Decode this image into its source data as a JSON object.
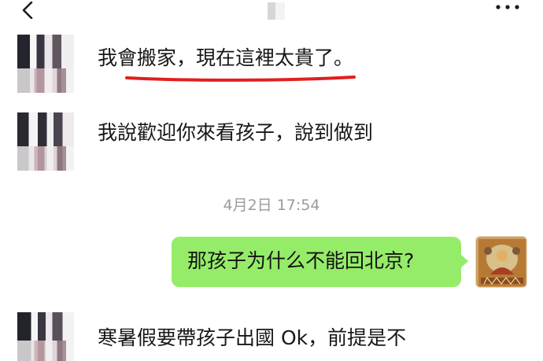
{
  "header": {
    "back_icon": "chevron-left-icon",
    "more_icon": "more-dots-icon"
  },
  "messages": [
    {
      "side": "left",
      "text": "我會搬家，現在這裡太貴了。",
      "highlighted": true,
      "highlight_color": "#e0201c"
    },
    {
      "side": "left",
      "text": "我說歡迎你來看孩子，說到做到"
    },
    {
      "side": "right",
      "text": "那孩子为什么不能回北京?",
      "bubble_color": "#95ec69"
    },
    {
      "side": "left",
      "text": "寒暑假要帶孩子出國 Ok，前提是不"
    }
  ],
  "timestamp": "4月2日 17:54",
  "self_avatar": "religious-painting-avatar"
}
